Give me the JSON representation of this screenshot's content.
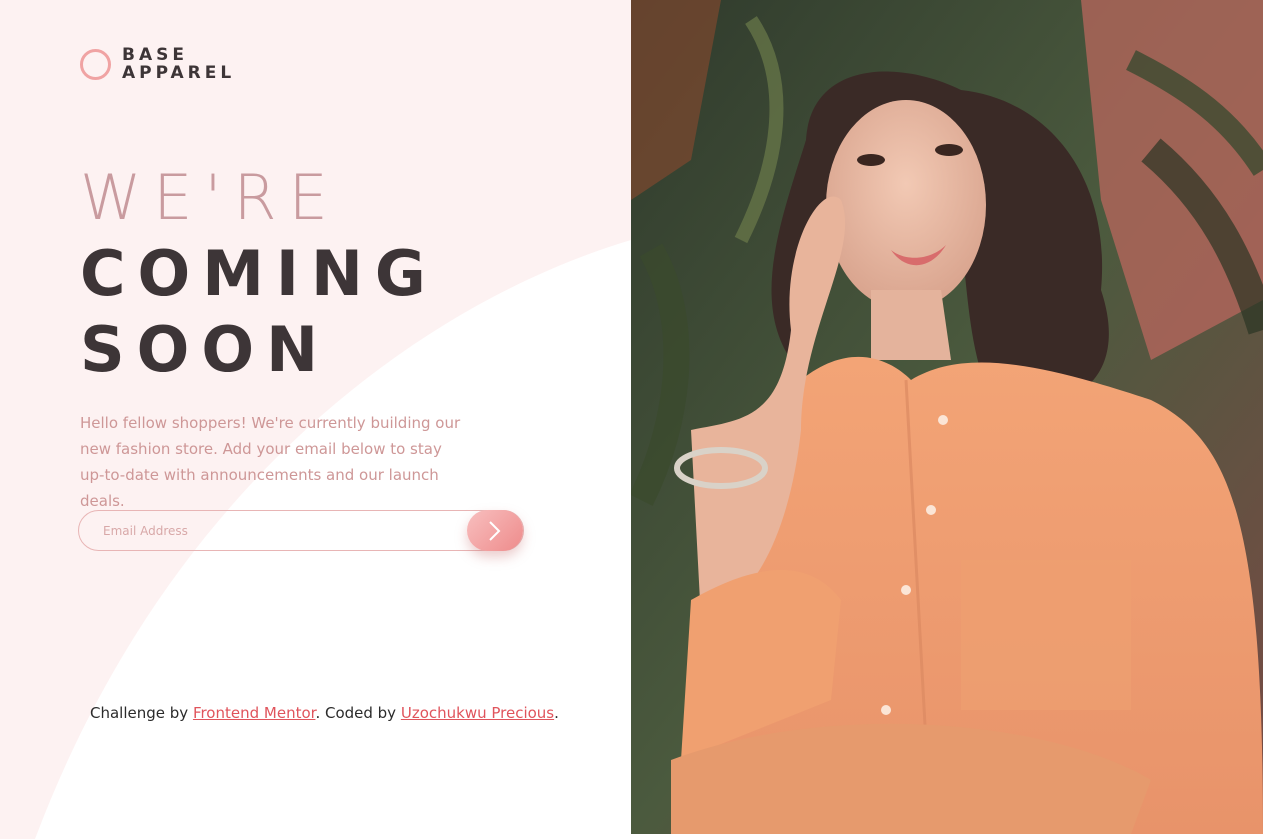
{
  "logo": {
    "line1": "BASE",
    "line2": "APPAREL"
  },
  "headline": {
    "light": "WE'RE",
    "bold_line1": "COMING",
    "bold_line2": "SOON"
  },
  "description": "Hello fellow shoppers! We're currently building our new fashion store. Add your email below to stay up-to-date with announcements and our launch deals.",
  "form": {
    "email_placeholder": "Email Address",
    "submit_icon": "chevron-right-icon"
  },
  "footer": {
    "challenge_prefix": "Challenge by ",
    "challenge_link": "Frontend Mentor",
    "coded_prefix": ". Coded by ",
    "coded_link": "Uzochukwu Precious",
    "suffix": "."
  },
  "hero": {
    "image": "woman-in-orange-shirt-photo"
  },
  "colors": {
    "accent": "#f0a3a3",
    "heading_light": "#c99b9f",
    "heading_dark": "#3d3537",
    "text": "#ce9797",
    "link": "#e0545c",
    "shirt": "#f0a070"
  }
}
